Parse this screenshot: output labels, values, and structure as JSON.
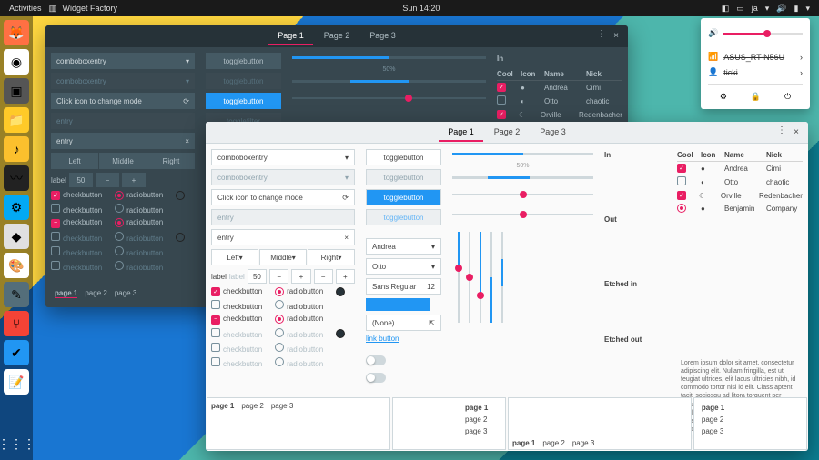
{
  "topbar": {
    "activities": "Activities",
    "app": "Widget Factory",
    "clock": "Sun 14:20",
    "lang": "ja"
  },
  "sysmenu": {
    "wifi": "ASUS_RT-N56U",
    "user": "ticki",
    "vol": 55
  },
  "tabs": {
    "p1": "Page 1",
    "p2": "Page 2",
    "p3": "Page 3"
  },
  "fields": {
    "combo": "comboboxentry",
    "combo_dim": "comboboxentry",
    "mode": "Click icon to change mode",
    "entry": "entry",
    "entry_dim": "entry",
    "left": "Left",
    "middle": "Middle",
    "right": "Right",
    "label": "label",
    "spin": "50"
  },
  "toggles": {
    "tb": "togglebutton",
    "tf": "togglefilter"
  },
  "checks": {
    "cb": "checkbutton",
    "rb": "radiobutton"
  },
  "frames": {
    "in": "In",
    "out": "Out",
    "ein": "Etched in",
    "eout": "Etched out"
  },
  "table": {
    "h": {
      "cool": "Cool",
      "icon": "Icon",
      "name": "Name",
      "nick": "Nick"
    },
    "rows": [
      {
        "cool": true,
        "icon": "●",
        "name": "Andrea",
        "nick": "Cimi"
      },
      {
        "cool": false,
        "icon": "◐",
        "name": "Otto",
        "nick": "chaotic"
      },
      {
        "cool": true,
        "icon": "☾",
        "name": "Orville",
        "nick": "Redenbacher"
      },
      {
        "cool": false,
        "icon": "●",
        "name": "Benjamin",
        "nick": "Company"
      }
    ]
  },
  "extras": {
    "andrea": "Andrea",
    "otto": "Otto",
    "font": "Sans Regular",
    "fontsize": "12",
    "none": "(None)",
    "link": "link button",
    "pct": "50%"
  },
  "lorem": "Lorem ipsum dolor sit amet, consectetur adipiscing elit. Nullam fringilla, est ut feugiat ultrices, elit lacus ultricies nibh, id commodo tortor nisi id elit. Class aptent taciti sociosqu ad litora torquent per conubia nostra, per inceptos himenaeos. Morbi vel elit erat. Maecenas dignissim, dui et pharetra rutrum, tellus lectus rutrum mi, a convallis libero nisi quis tellus. Nulla facilisi. Nullam eleifend",
  "minitabs": {
    "p1": "page 1",
    "p2": "page 2",
    "p3": "page 3"
  }
}
